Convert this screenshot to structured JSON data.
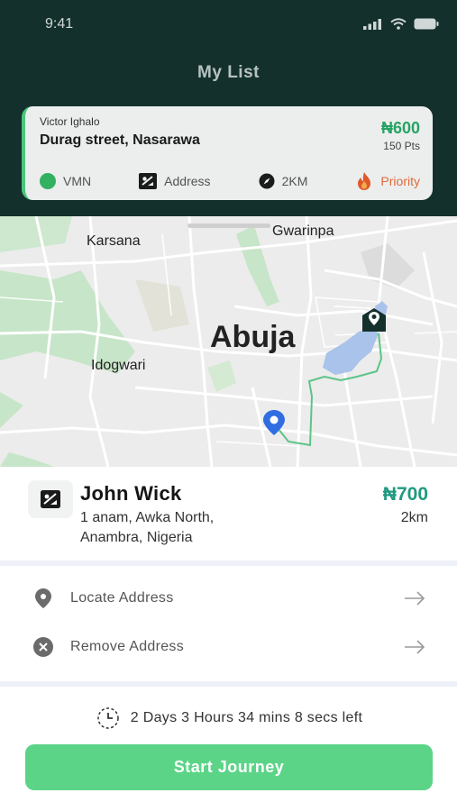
{
  "status_bar": {
    "time": "9:41"
  },
  "header": {
    "title": "My List"
  },
  "list_card": {
    "name": "Victor Ighalo",
    "street": "Durag street, Nasarawa",
    "price": "₦600",
    "points": "150 Pts",
    "tags": {
      "vmn": "VMN",
      "address": "Address",
      "distance": "2KM",
      "priority": "Priority"
    }
  },
  "map": {
    "labels": {
      "karsana": "Karsana",
      "gwarinpa": "Gwarinpa",
      "abuja": "Abuja",
      "idogwari": "Idogwari"
    }
  },
  "detail": {
    "name": "John Wick",
    "address_line1": "1 anam, Awka North,",
    "address_line2": "Anambra, Nigeria",
    "price": "₦700",
    "distance": "2km"
  },
  "actions": [
    {
      "label": "Locate Address",
      "icon": "location-pin-icon"
    },
    {
      "label": "Remove Address",
      "icon": "close-circle-icon"
    }
  ],
  "timer": {
    "text": "2 Days 3 Hours 34 mins 8 secs left"
  },
  "primary_button": {
    "label": "Start Journey"
  },
  "colors": {
    "header_bg": "#14302c",
    "accent_green": "#5bd487",
    "price_teal": "#1f9a7f",
    "priority_orange": "#e86c3c"
  }
}
